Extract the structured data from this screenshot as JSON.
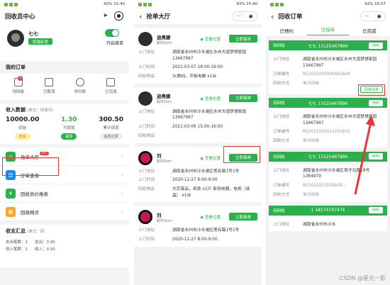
{
  "status": {
    "p1_battery": "43%",
    "p1_time": "15:40",
    "p2_battery": "43%",
    "p2_time": "15:40",
    "p3_battery": "42%",
    "p3_time": "16:07"
  },
  "p1": {
    "title": "回收员中心",
    "user_name": "七七",
    "user_tag": "刺激卧室",
    "toggle_label": "开启接单",
    "my_orders": "我的订单",
    "orders": [
      {
        "label": "待回收",
        "badge": "1"
      },
      {
        "label": "已取消"
      },
      {
        "label": "待付款"
      },
      {
        "label": "已完成"
      }
    ],
    "income_title": "收入数据",
    "income_unit": "(单位：回收币)",
    "income": [
      {
        "value": "10000.00",
        "label": "初始",
        "btn": "去充"
      },
      {
        "value": "1.30",
        "label": "可提现",
        "btn": "提现"
      },
      {
        "value": "300.50",
        "label": "累计提现",
        "btn": "提现记录"
      }
    ],
    "menu": [
      {
        "label": "抢单大厅",
        "badge": "107",
        "color": "#2bb14b",
        "glyph": "⌂"
      },
      {
        "label": "订单查询",
        "color": "#1e88e5",
        "glyph": "▤"
      },
      {
        "label": "回收员价格表",
        "color": "#2bb14b",
        "glyph": "¥"
      },
      {
        "label": "回收网点",
        "color": "#f9a825",
        "glyph": "▦"
      }
    ],
    "summary_title": "收支汇总",
    "summary_unit": "(单位：回",
    "summary_rows": [
      "支出笔数：1",
      "收入笔数：1"
    ],
    "summary_values": [
      "支出：0.90",
      "收入：0.90"
    ]
  },
  "p2": {
    "title": "抢单大厅",
    "view_loc": "查看位置",
    "grab_label": "立即接单",
    "keys": {
      "address": "上门地址",
      "time": "上门时间",
      "items": "回收物品"
    },
    "cards": [
      {
        "name": "迪奥娜",
        "dist": "距你1km",
        "address": "湖南省永州市冷水滩区永州大道梦想家园13467997",
        "time": "2021-03-07 18:00-19:00",
        "items": "3c数码，平板电脑 x1台",
        "pink": false
      },
      {
        "name": "迪奥娜",
        "dist": "距你1km",
        "address": "湖南省永州市冷水滩区永州大道梦想家园13467997",
        "time": "2021-03-06 15:00-16:00",
        "items": "",
        "pink": false
      },
      {
        "name": "刘",
        "dist": "距你1km",
        "address": "湖南省永州市冷水滩区莲云路1号1号",
        "time": "2020-12-27 8:00-9:00",
        "items": "大宗废品，纸类 x1斤 家用电器，电视（液晶） x1台",
        "pink": true
      },
      {
        "name": "刘",
        "dist": "距你1km",
        "address": "湖南省永州市冷水滩区莲云路1号1号",
        "time": "2020-12-27 8:00-9:00",
        "items": "",
        "pink": true
      }
    ]
  },
  "p3": {
    "title": "回收订单",
    "tabs": [
      "已预约",
      "已接单",
      "已完成"
    ],
    "call": "呼叫",
    "status_label": "待回收",
    "keys": {
      "address": "上门地址",
      "order_no": "订单编号",
      "method": "回收方式"
    },
    "method_value": "单次回收",
    "confirm": "回收清单",
    "orders": [
      {
        "contact": "七七 13125467896",
        "address": "湖南省永州市冷水滩区永州大道梦想家园13467997",
        "order_no": "RE2021030906565849"
      },
      {
        "contact": "七七 13125467896",
        "address": "湖南省永州市冷水滩区永州大道梦想家园13467997",
        "order_no": "RE2021030910255815"
      },
      {
        "contact": "七七 13125467896",
        "address": "湖南省永州市冷水滩区育才北路18号1364979",
        "order_no": "RE2021022505649..."
      },
      {
        "contact": "1 18174747474",
        "address": "湖南省永州市冷水",
        "order_no": ""
      }
    ],
    "watermark": "CSDN @星光一影"
  }
}
